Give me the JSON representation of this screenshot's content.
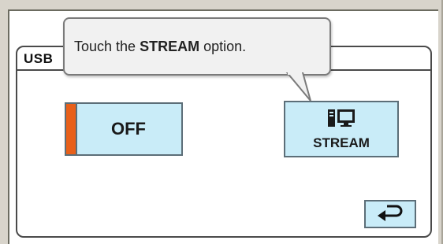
{
  "tooltip": {
    "text_before": "Touch the ",
    "text_bold": "STREAM",
    "text_after": " option."
  },
  "panel": {
    "title": "USB"
  },
  "buttons": {
    "off_label": "OFF",
    "stream_label": "STREAM",
    "back_icon": "return-arrow-icon",
    "stream_icon": "pc-tower-monitor-icon"
  },
  "colors": {
    "button_fill": "#c9ecf8",
    "indicator_orange": "#e8601a",
    "frame": "#d8d4cb"
  }
}
